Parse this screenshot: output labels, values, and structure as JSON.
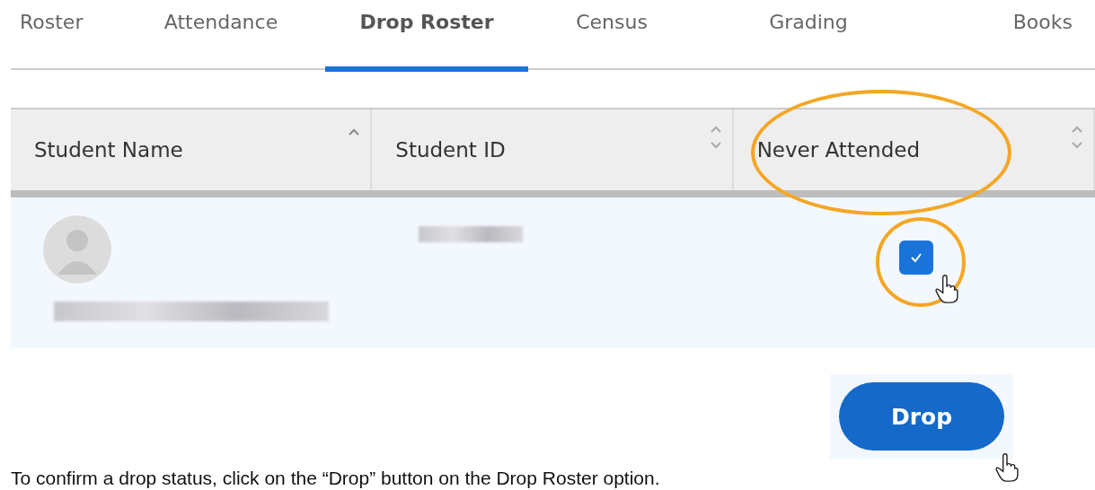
{
  "tabs": [
    {
      "label": "Roster",
      "selected": false
    },
    {
      "label": "Attendance",
      "selected": false
    },
    {
      "label": "Drop Roster",
      "selected": true
    },
    {
      "label": "Census",
      "selected": false
    },
    {
      "label": "Grading",
      "selected": false
    },
    {
      "label": "Books",
      "selected": false
    }
  ],
  "table": {
    "columns": [
      {
        "label": "Student Name",
        "sorted_ascending": true,
        "highlighted": false
      },
      {
        "label": "Student ID",
        "sorted_ascending": false,
        "highlighted": false
      },
      {
        "label": "Never Attended",
        "sorted_ascending": false,
        "highlighted": true
      }
    ],
    "rows": [
      {
        "never_attended": {
          "checked": true,
          "highlighted": true
        }
      }
    ]
  },
  "drop_button": {
    "label": "Drop"
  },
  "caption": "To confirm a drop status, click on the “Drop” button on the Drop Roster option."
}
